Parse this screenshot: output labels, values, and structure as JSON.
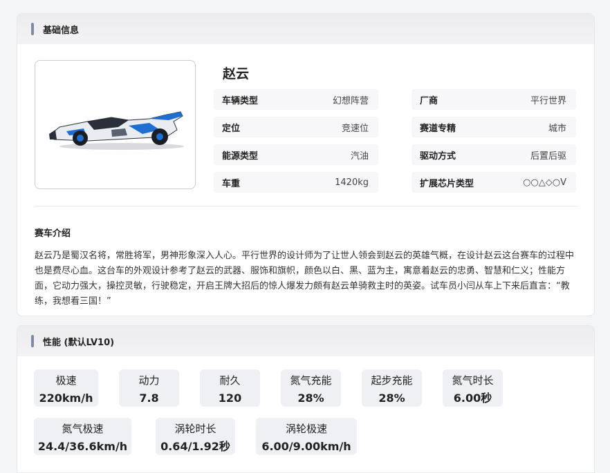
{
  "basic": {
    "header_title": "基础信息",
    "car_name": "赵云",
    "specs": [
      {
        "key": "车辆类型",
        "value": "幻想阵营"
      },
      {
        "key": "厂商",
        "value": "平行世界"
      },
      {
        "key": "定位",
        "value": "竞速位"
      },
      {
        "key": "赛道专精",
        "value": "城市"
      },
      {
        "key": "能源类型",
        "value": "汽油"
      },
      {
        "key": "驱动方式",
        "value": "后置后驱"
      },
      {
        "key": "车重",
        "value": "1420kg"
      },
      {
        "key": "扩展芯片类型",
        "value": "○○△◇○V"
      }
    ],
    "intro_title": "赛车介绍",
    "intro_text": "赵云乃是蜀汉名将，常胜将军，男神形象深入人心。平行世界的设计师为了让世人领会到赵云的英雄气概，在设计赵云这台赛车的过程中也是费尽心血。这台车的外观设计参考了赵云的武器、服饰和旗帜，颜色以白、黑、蓝为主，寓意着赵云的忠勇、智慧和仁义；性能方面，它动力强大，操控灵敏，行驶稳定，开启王牌大招后的惊人爆发力颇有赵云单骑救主时的英姿。试车员小闫从车上下来后直言：“教练，我想看三国！”"
  },
  "performance": {
    "header_title": "性能 (默认LV10)",
    "stats": [
      {
        "label": "极速",
        "value": "220km/h"
      },
      {
        "label": "动力",
        "value": "7.8"
      },
      {
        "label": "耐久",
        "value": "120"
      },
      {
        "label": "氮气充能",
        "value": "28%"
      },
      {
        "label": "起步充能",
        "value": "28%"
      },
      {
        "label": "氮气时长",
        "value": "6.00秒"
      },
      {
        "label": "氮气极速",
        "value": "24.4/36.6km/h"
      },
      {
        "label": "涡轮时长",
        "value": "0.64/1.92秒"
      },
      {
        "label": "涡轮极速",
        "value": "6.00/9.00km/h"
      }
    ]
  },
  "colors": {
    "accent_bar": "#7f8aa3",
    "stat_bg": "#eef0f3",
    "spec_bg": "#f7f7f9",
    "car_blue": "#1f6fd1"
  }
}
